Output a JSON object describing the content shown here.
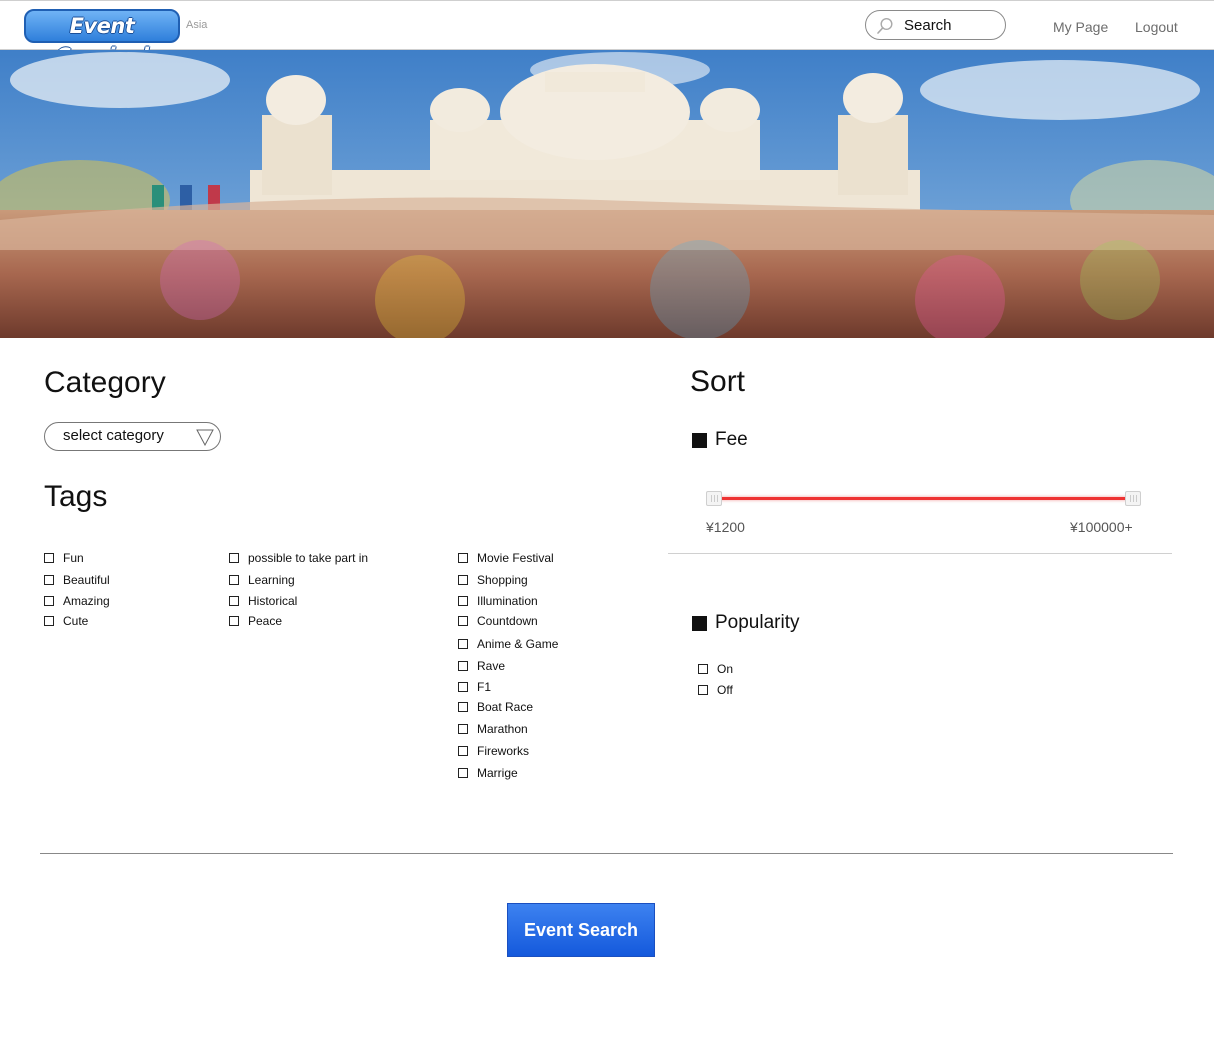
{
  "header": {
    "logo": "Event Carnival",
    "region": "Asia",
    "search": {
      "placeholder": "Search"
    },
    "nav": {
      "my_page": "My Page",
      "logout": "Logout"
    }
  },
  "category": {
    "heading": "Category",
    "select_label": "select category"
  },
  "tags": {
    "heading": "Tags",
    "col1": [
      "Fun",
      "Beautiful",
      "Amazing",
      "Cute"
    ],
    "col2": [
      "possible to take part in",
      "Learning",
      "Historical",
      "Peace"
    ],
    "col3": [
      "Movie Festival",
      "Shopping",
      "Illumination",
      "Countdown",
      "Anime & Game",
      "Rave",
      "F1",
      "Boat Race",
      "Marathon",
      "Fireworks",
      "Marrige"
    ]
  },
  "sort": {
    "heading": "Sort",
    "fee": {
      "label": "Fee",
      "min_label": "¥1200",
      "max_label": "¥100000+"
    },
    "popularity": {
      "label": "Popularity",
      "options": [
        "On",
        "Off"
      ]
    }
  },
  "actions": {
    "search_button": "Event Search"
  },
  "colors": {
    "accent": "#1f5fdc",
    "slider": "#e33333",
    "logo": "#2f7fdb"
  }
}
